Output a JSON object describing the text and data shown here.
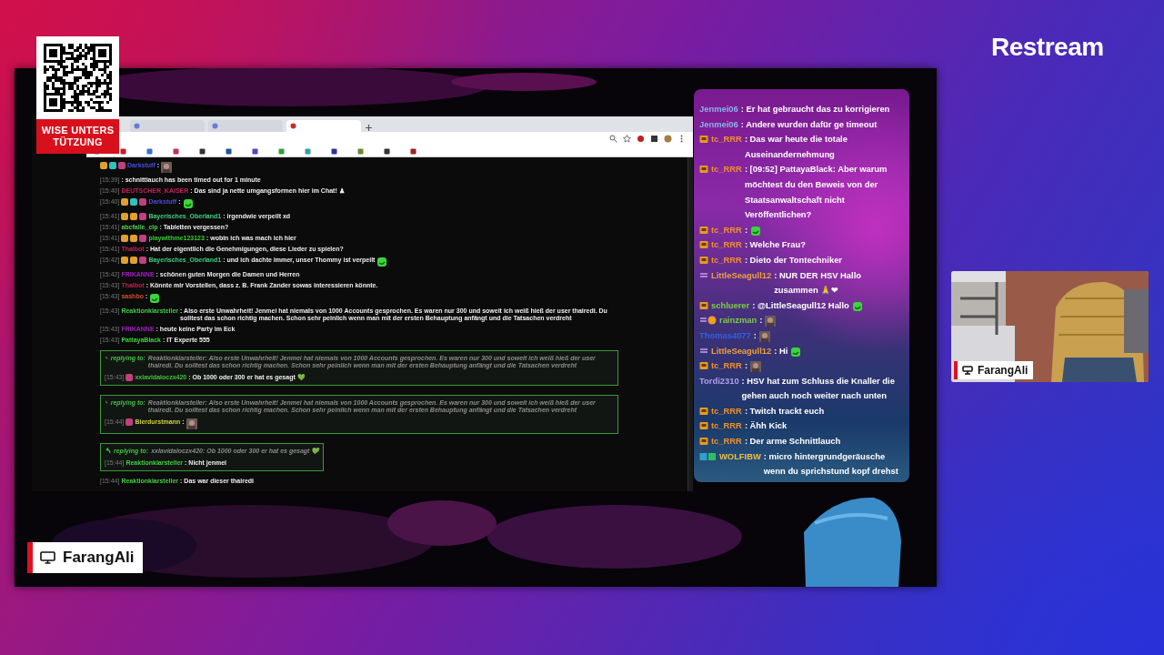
{
  "logo": "Restream",
  "donation": {
    "label": "WISE UNTERSTÜTZUNG"
  },
  "browser": {
    "tabs": [
      {
        "selected": false
      },
      {
        "selected": false
      },
      {
        "selected": true
      }
    ]
  },
  "left_chat": [
    {
      "kind": "message",
      "badges": [
        {
          "color": "#e0a030"
        },
        {
          "color": "#30c0c0"
        },
        {
          "color": "#c04080"
        }
      ],
      "user": "Darkstuff",
      "color": "#4a4ae0",
      "text": ":"
    },
    {
      "kind": "system",
      "time": "[15:39]",
      "text": ": schnittlauch has been timed out for 1 minute"
    },
    {
      "kind": "message",
      "time": "[15:40]",
      "user": "DEUTSCHER_KAISER",
      "color": "#c02060",
      "text": ": Das sind ja nette umgangsformen hier im Chat! ♟"
    },
    {
      "kind": "message",
      "time": "[15:40]",
      "badges": [
        {
          "color": "#e0a030"
        },
        {
          "color": "#30c0c0"
        },
        {
          "color": "#c04080"
        }
      ],
      "user": "Darkstuff",
      "color": "#4a4ae0",
      "text": ":",
      "emote": {
        "kind": "green"
      }
    },
    {
      "kind": "message",
      "time": "[15:41]",
      "badges": [
        {
          "color": "#e0a030"
        },
        {
          "color": "#e0a030"
        },
        {
          "color": "#c04080"
        }
      ],
      "user": "Bayerisches_Oberland1",
      "color": "#40d080",
      "text": ": irgendwie verpeilt xd"
    },
    {
      "kind": "message",
      "time": "[15:41]",
      "user": "abcfalle_clp",
      "color": "#50d050",
      "text": ": Tabletten vergessen?"
    },
    {
      "kind": "message",
      "time": "[15:41]",
      "badges": [
        {
          "color": "#e0a030"
        },
        {
          "color": "#e0a030"
        },
        {
          "color": "#c04080"
        }
      ],
      "user": "playwithme123123",
      "color": "#30d030",
      "text": ": wobin ich was mach ich hier"
    },
    {
      "kind": "message",
      "time": "[15:41]",
      "user": "Thalbot",
      "color": "#c02050",
      "text": ": Hat der eigentlich die Genehmigungen, diese Lieder zu spielen?"
    },
    {
      "kind": "message",
      "time": "[15:42]",
      "badges": [
        {
          "color": "#e0a030"
        },
        {
          "color": "#e0a030"
        },
        {
          "color": "#c04080"
        }
      ],
      "user": "Bayerisches_Oberland1",
      "color": "#40d080",
      "text": ": und ich dachte immer, unser Thommy ist verpeilt",
      "emote": {
        "kind": "green"
      }
    },
    {
      "kind": "message",
      "time": "[15:42]",
      "user": "FRIKANNE",
      "color": "#a020c0",
      "text": ": schönen guten Morgen die Damen und Herren"
    },
    {
      "kind": "message",
      "time": "[15:43]",
      "user": "Thalbot",
      "color": "#c02050",
      "text": ": Könnte mir Vorstellen, dass z. B. Frank Zander sowas interessieren könnte."
    },
    {
      "kind": "message",
      "time": "[15:43]",
      "user": "sashbo",
      "color": "#d05030",
      "text": ":",
      "emote": {
        "kind": "green"
      }
    },
    {
      "kind": "message",
      "time": "[15:43]",
      "user": "Reaktionklarsteller",
      "color": "#40d040",
      "text": ": Also erste Unwahrheit! Jenmei hat niemals von 1000 Accounts gesprochen. Es waren nur 300 und soweit ich weiß hieß der user thairedi. Du solltest das schon richtig machen. Schon sehr peinlich wenn man mit der ersten Behauptung anfängt und die Tatsachen verdreht"
    },
    {
      "kind": "message",
      "time": "[15:43]",
      "user": "FRIKANNE",
      "color": "#a020c0",
      "text": ": heute keine Party im Eck"
    },
    {
      "kind": "message",
      "time": "[15:43]",
      "user": "PattayaBlack",
      "color": "#40d040",
      "text": ": IT Experte 555"
    },
    {
      "kind": "reply",
      "wide": true,
      "reply_label": "replying to:",
      "quote": "Reaktionklarsteller: Also erste Unwahrheit! Jenmei hat niemals von 1000 Accounts gesprochen. Es waren nur 300 und soweit ich weiß hieß der user thairedi. Du solltest das schon richtig machen. Schon sehr peinlich wenn man mit der ersten Behauptung anfängt und die Tatsachen verdreht",
      "time": "[15:43]",
      "badges": [
        {
          "color": "#c04080"
        }
      ],
      "user": "xxlavidaloczx420",
      "color": "#40c040",
      "text": ": Ob 1000 oder 300 er hat es gesagt 💚"
    },
    {
      "kind": "reply",
      "wide": true,
      "reply_label": "replying to:",
      "quote": "Reaktionklarsteller: Also erste Unwahrheit! Jenmei hat niemals von 1000 Accounts gesprochen. Es waren nur 300 und soweit ich weiß hieß der user thairedi. Du solltest das schon richtig machen. Schon sehr peinlich wenn man mit der ersten Behauptung anfängt und die Tatsachen verdreht",
      "time": "[15:44]",
      "badges": [
        {
          "color": "#c04080"
        }
      ],
      "user": "Bierdurstmann",
      "color": "#d0d040",
      "text": ":"
    },
    {
      "kind": "reply",
      "wide": false,
      "reply_label": "replying to:",
      "quote": "xxlavidaloczx420: Ob 1000 oder 300 er hat es gesagt 💚",
      "time": "[15:44]",
      "user": "Reaktionklarsteller",
      "color": "#40d040",
      "text": ": Nicht jenmei"
    },
    {
      "kind": "message",
      "time": "[15:44]",
      "user": "Reaktionklarsteller",
      "color": "#40d040",
      "text": ": Das war dieser thairedi"
    }
  ],
  "side_chat": [
    {
      "user": "Jenmei06",
      "color": "#8ab4e8",
      "text": ": Er hat gebraucht das zu korrigieren"
    },
    {
      "user": "Jenmei06",
      "color": "#8ab4e8",
      "text": ": Andere wurden dafür ge timeout"
    },
    {
      "badge": {
        "kind": "sub"
      },
      "user": "tc_RRR",
      "color": "#f0902a",
      "text": ": Das war heute die totale Auseinandernehmung"
    },
    {
      "badge": {
        "kind": "sub"
      },
      "user": "tc_RRR",
      "color": "#f0902a",
      "text": ": [09:52] PattayaBlack: Aber warum möchtest du den Beweis von der Staatsanwaltschaft nicht Veröffentlichen?"
    },
    {
      "badge": {
        "kind": "sub"
      },
      "user": "tc_RRR",
      "color": "#f0902a",
      "text": ":",
      "emote": {
        "kind": "green"
      }
    },
    {
      "badge": {
        "kind": "sub"
      },
      "user": "tc_RRR",
      "color": "#f0902a",
      "text": ": Welche Frau?"
    },
    {
      "badge": {
        "kind": "sub"
      },
      "user": "tc_RRR",
      "color": "#f0902a",
      "text": ": Dieto der Tontechniker"
    },
    {
      "badge": {
        "kind": "menu"
      },
      "user": "LittleSeagull12",
      "color": "#f0a040",
      "text": ": NUR DER HSV Hallo zusammen 🙏❤"
    },
    {
      "badge": {
        "kind": "sub"
      },
      "user": "schluerer",
      "color": "#7ad040",
      "text": ": @LittleSeagull12 Hallo",
      "emote": {
        "kind": "green"
      }
    },
    {
      "badge": {
        "kind": "menu-coin"
      },
      "user": "rainzman",
      "color": "#7ad040",
      "text": ":"
    },
    {
      "user": "Thomas4077",
      "color": "#3060e0",
      "text": ":"
    },
    {
      "badge": {
        "kind": "menu"
      },
      "user": "LittleSeagull12",
      "color": "#f0a040",
      "text": ": Hi",
      "emote": {
        "kind": "green"
      }
    },
    {
      "badge": {
        "kind": "sub"
      },
      "user": "tc_RRR",
      "color": "#f0902a",
      "text": ":"
    },
    {
      "user": "Tordi2310",
      "color": "#b0a0f0",
      "text": ": HSV hat zum Schluss die Knaller die gehen auch noch weiter nach unten"
    },
    {
      "badge": {
        "kind": "sub"
      },
      "user": "tc_RRR",
      "color": "#f0902a",
      "text": ": Twitch trackt euch"
    },
    {
      "badge": {
        "kind": "sub"
      },
      "user": "tc_RRR",
      "color": "#f0902a",
      "text": ": Ähh Kick"
    },
    {
      "badge": {
        "kind": "sub"
      },
      "user": "tc_RRR",
      "color": "#f0902a",
      "text": ": Der arme Schnittlauch"
    },
    {
      "badge": {
        "kind": "mod"
      },
      "user": "WOLFIBW",
      "color": "#f0c040",
      "text": ": micro hintergrundgeräusche wenn du sprichstund kopf drehst"
    }
  ],
  "cam_label": "FarangAli",
  "screen_label": "FarangAli"
}
